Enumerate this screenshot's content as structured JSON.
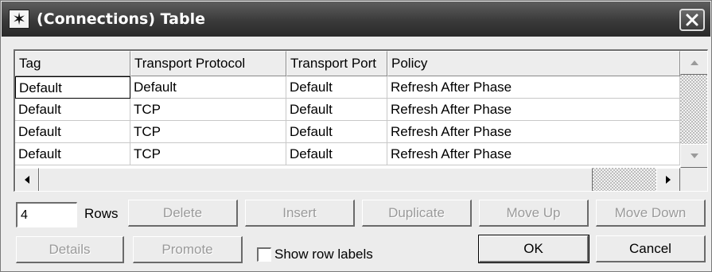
{
  "window": {
    "title": "(Connections) Table"
  },
  "icons": {
    "app": "asterisk-icon",
    "close": "close-icon",
    "scroll_up": "scroll-up-arrow-icon",
    "scroll_down": "scroll-down-arrow-icon",
    "scroll_left": "scroll-left-arrow-icon",
    "scroll_right": "scroll-right-arrow-icon"
  },
  "table": {
    "columns": [
      "Tag",
      "Transport Protocol",
      "Transport Port",
      "Policy"
    ],
    "rows": [
      [
        "Default",
        "Default",
        "Default",
        "Refresh After Phase"
      ],
      [
        "Default",
        "TCP",
        "Default",
        "Refresh After Phase"
      ],
      [
        "Default",
        "TCP",
        "Default",
        "Refresh After Phase"
      ],
      [
        "Default",
        "TCP",
        "Default",
        "Refresh After Phase"
      ]
    ]
  },
  "controls": {
    "rows_value": "4",
    "rows_label": "Rows",
    "delete_label": "Delete",
    "insert_label": "Insert",
    "duplicate_label": "Duplicate",
    "move_up_label": "Move Up",
    "move_down_label": "Move Down",
    "details_label": "Details",
    "promote_label": "Promote",
    "show_row_labels_label": "Show row labels",
    "show_row_labels_checked": false,
    "ok_label": "OK",
    "cancel_label": "Cancel"
  }
}
